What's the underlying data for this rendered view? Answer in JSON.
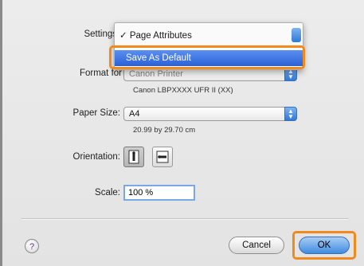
{
  "settings": {
    "label": "Settings",
    "menu": [
      {
        "label": "✓ Page Attributes",
        "selected": false
      },
      {
        "label": "Save As Default",
        "selected": true
      }
    ]
  },
  "format_for": {
    "label": "Format for",
    "value": "Canon Printer",
    "sub": "Canon LBPXXXX UFR II (XX)"
  },
  "paper_size": {
    "label": "Paper Size:",
    "value": "A4",
    "sub": "20.99 by 29.70 cm"
  },
  "orientation": {
    "label": "Orientation:",
    "options": [
      "portrait-icon",
      "landscape-icon"
    ],
    "selected": "portrait-icon"
  },
  "scale": {
    "label": "Scale:",
    "value": "100 %"
  },
  "buttons": {
    "cancel": "Cancel",
    "ok": "OK",
    "help": "?"
  },
  "colors": {
    "highlight": "#f08a1c",
    "accent": "#2a62d8"
  }
}
